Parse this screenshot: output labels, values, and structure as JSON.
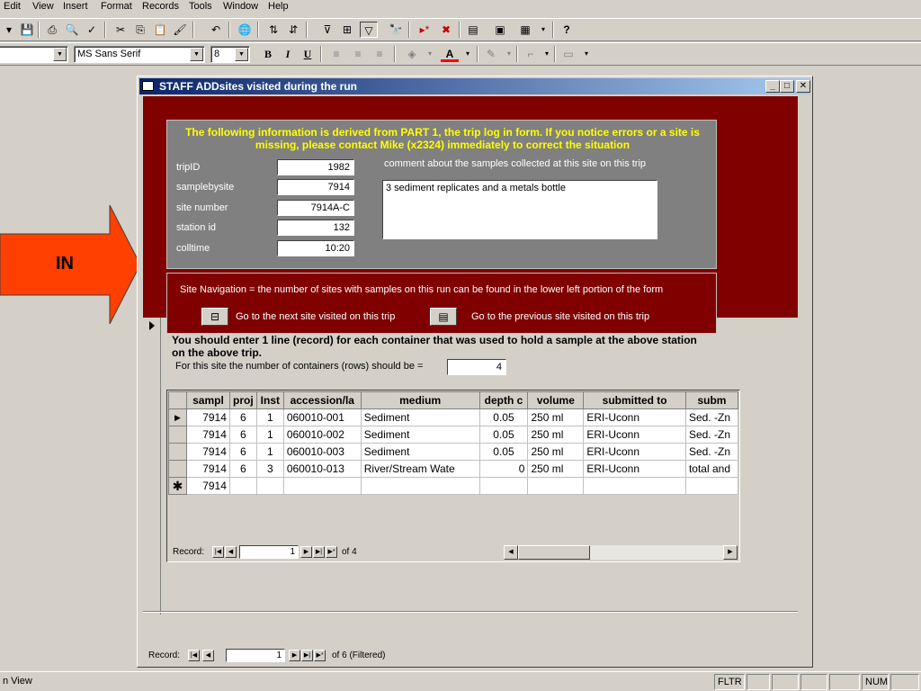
{
  "menu": [
    "Edit",
    "View",
    "Insert",
    "Format",
    "Records",
    "Tools",
    "Window",
    "Help"
  ],
  "toolbar": {
    "font_name": "MS Sans Serif",
    "font_size": "8",
    "bold": "B",
    "italic": "I",
    "underline": "U"
  },
  "callout": {
    "label": "IN",
    "color": "#ff4000"
  },
  "window": {
    "title": "STAFF ADDsites visited during the run"
  },
  "info": {
    "title": "The following information is derived from PART 1, the trip log in form.  If you notice errors or a site is missing, please contact Mike (x2324) immediately to correct the situation",
    "fields": [
      {
        "label": "tripID",
        "value": "1982"
      },
      {
        "label": "samplebysite",
        "value": "7914"
      },
      {
        "label": "site number",
        "value": "7914A-C"
      },
      {
        "label": "station id",
        "value": "132"
      },
      {
        "label": "colltime",
        "value": "10:20"
      }
    ],
    "comment_label": "comment about the samples collected at this site on this trip",
    "comment_value": "3 sediment replicates and a metals bottle"
  },
  "nav": {
    "text": "Site Navigation = the number of sites with samples on this run can be found in the lower left portion of the form",
    "next_label": "Go to the next site visited on this trip",
    "prev_label": "Go to the previous site visited on this trip"
  },
  "detail": {
    "instruction": "You should enter 1 line (record) for each container that was used to hold a sample at the above station on the above trip.",
    "count_label": "For this site the number of containers (rows) should be =",
    "count_value": "4"
  },
  "datasheet": {
    "columns": [
      "sampl",
      "proj",
      "Inst",
      "accession/la",
      "medium",
      "depth c",
      "volume",
      "submitted to",
      "subm"
    ],
    "rows": [
      [
        "7914",
        "6",
        "1",
        "060010-001",
        "Sediment",
        "0.05",
        "250 ml",
        "ERI-Uconn",
        "Sed. -Zn"
      ],
      [
        "7914",
        "6",
        "1",
        "060010-002",
        "Sediment",
        "0.05",
        "250 ml",
        "ERI-Uconn",
        "Sed. -Zn"
      ],
      [
        "7914",
        "6",
        "1",
        "060010-003",
        "Sediment",
        "0.05",
        "250 ml",
        "ERI-Uconn",
        "Sed. -Zn"
      ],
      [
        "7914",
        "6",
        "3",
        "060010-013",
        "River/Stream Wate",
        "0",
        "250 ml",
        "ERI-Uconn",
        "total and"
      ]
    ],
    "new_row_value": "7914",
    "record_label": "Record:",
    "record_current": "1",
    "record_of": "of 4"
  },
  "main_nav": {
    "record_label": "Record:",
    "record_current": "1",
    "record_of": "of 6 (Filtered)"
  },
  "status": {
    "left": "n View",
    "fltr": "FLTR",
    "num": "NUM"
  }
}
